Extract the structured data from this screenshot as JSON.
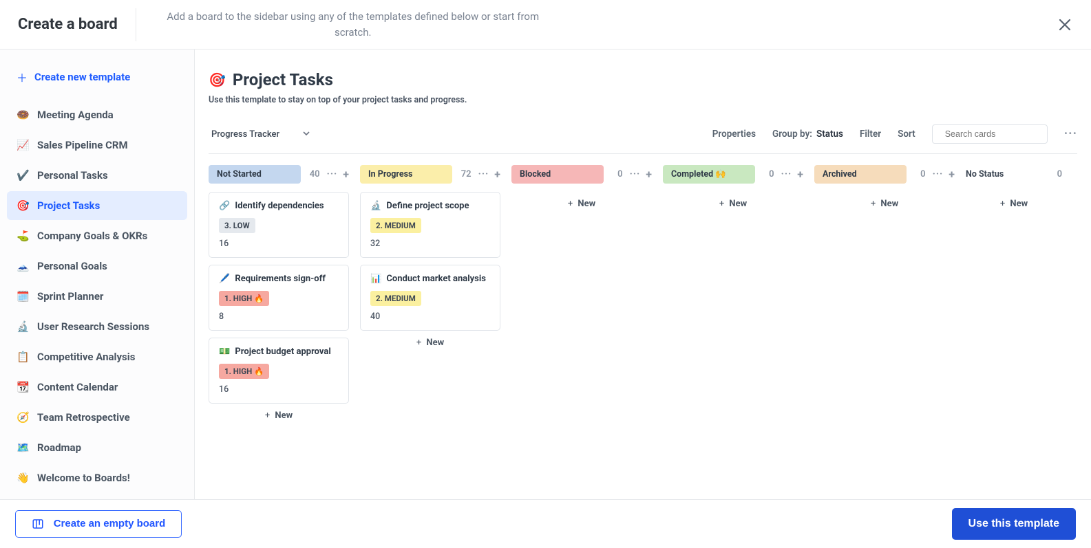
{
  "header": {
    "title": "Create a board",
    "subtitle": "Add a board to the sidebar using any of the templates defined below or start from scratch."
  },
  "sidebar": {
    "create_new_template": "Create new template",
    "items": [
      {
        "icon": "🍩",
        "label": "Meeting Agenda"
      },
      {
        "icon": "📈",
        "label": "Sales Pipeline CRM"
      },
      {
        "icon": "✔️",
        "label": "Personal Tasks"
      },
      {
        "icon": "🎯",
        "label": "Project Tasks",
        "active": true
      },
      {
        "icon": "⛳",
        "label": "Company Goals & OKRs"
      },
      {
        "icon": "🗻",
        "label": "Personal Goals"
      },
      {
        "icon": "🗓️",
        "label": "Sprint Planner"
      },
      {
        "icon": "🔬",
        "label": "User Research Sessions"
      },
      {
        "icon": "📋",
        "label": "Competitive Analysis"
      },
      {
        "icon": "📆",
        "label": "Content Calendar"
      },
      {
        "icon": "🧭",
        "label": "Team Retrospective"
      },
      {
        "icon": "🗺️",
        "label": "Roadmap"
      },
      {
        "icon": "👋",
        "label": "Welcome to Boards!"
      }
    ]
  },
  "main": {
    "icon": "🎯",
    "title": "Project Tasks",
    "description": "Use this template to stay on top of your project tasks and progress.",
    "view_name": "Progress Tracker",
    "toolbar": {
      "properties": "Properties",
      "group_by_label": "Group by:",
      "group_by_value": "Status",
      "filter": "Filter",
      "sort": "Sort",
      "search_placeholder": "Search cards"
    },
    "new_label": "New"
  },
  "board": {
    "columns": [
      {
        "name": "Not Started",
        "count": 40,
        "color": "bg-gray",
        "cards": [
          {
            "icon": "🔗",
            "title": "Identify dependencies",
            "priority": "3. LOW",
            "pclass": "tag-low",
            "num": 16
          },
          {
            "icon": "🖊️",
            "title": "Requirements sign-off",
            "priority": "1. HIGH 🔥",
            "pclass": "tag-high",
            "num": 8
          },
          {
            "icon": "💵",
            "title": "Project budget approval",
            "priority": "1. HIGH 🔥",
            "pclass": "tag-high",
            "num": 16
          }
        ]
      },
      {
        "name": "In Progress",
        "count": 72,
        "color": "bg-yellow",
        "cards": [
          {
            "icon": "🔬",
            "title": "Define project scope",
            "priority": "2. MEDIUM",
            "pclass": "tag-med",
            "num": 32
          },
          {
            "icon": "📊",
            "title": "Conduct market analysis",
            "priority": "2. MEDIUM",
            "pclass": "tag-med",
            "num": 40
          }
        ]
      },
      {
        "name": "Blocked",
        "count": 0,
        "color": "bg-red",
        "cards": []
      },
      {
        "name": "Completed 🙌",
        "count": 0,
        "color": "bg-green",
        "cards": []
      },
      {
        "name": "Archived",
        "count": 0,
        "color": "bg-orange",
        "cards": []
      },
      {
        "name": "No Status",
        "count": 0,
        "color": "nobg",
        "nostat": true,
        "cards": []
      }
    ]
  },
  "footer": {
    "empty_board": "Create an empty board",
    "use_template": "Use this template"
  }
}
